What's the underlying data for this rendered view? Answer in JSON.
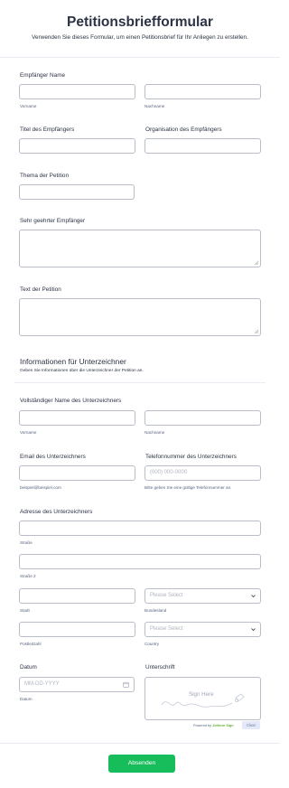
{
  "form": {
    "title": "Petitionsbriefformular",
    "subtitle": "Verwenden Sie dieses Formular, um einen Petitionsbrief für Ihr Anliegen zu erstellen."
  },
  "recipient": {
    "name_label": "Empfänger Name",
    "first_sublabel": "Vorname",
    "last_sublabel": "Nachname",
    "title_label": "Titel des Empfängers",
    "org_label": "Organisation des Empfängers",
    "topic_label": "Thema der Petition",
    "salutation_label": "Sehr geehrter Empfänger",
    "petition_text_label": "Text der Petition"
  },
  "signer_section": {
    "heading": "Informationen für Unterzeichner",
    "description": "Geben Sie Informationen über die Unterzeichner der Petition an.",
    "fullname_label": "Vollständiger Name des Unterzeichners",
    "first_sublabel": "Vorname",
    "last_sublabel": "Nachname",
    "email_label": "Email des Unterzeichners",
    "email_sublabel": "beispiel@beispiel.com",
    "phone_label": "Telefonnummer des Unterzeichners",
    "phone_placeholder": "(000) 000-0000",
    "phone_sublabel": "Bitte geben Sie eine gültige Telefonnummer an.",
    "address_label": "Adresse des Unterzeichners",
    "street_sublabel": "Straße",
    "street2_sublabel": "Straße 2",
    "city_sublabel": "Stadt",
    "state_placeholder": "Please Select",
    "state_sublabel": "Bundesland",
    "zip_sublabel": "Postleitzahl",
    "country_placeholder": "Please Select",
    "country_sublabel": "Country",
    "date_label": "Datum",
    "date_placeholder": "MM-DD-YYYY",
    "date_sublabel": "Datum",
    "signature_label": "Unterschrift",
    "sign_here": "Sign Here",
    "powered_by": "Powered by",
    "powered_brand": "Jotform Sign",
    "clear_label": "Clear"
  },
  "submit_label": "Absenden",
  "colors": {
    "submit": "#18bd5b",
    "border": "#b8bdc9",
    "text": "#2c3345",
    "placeholder": "#b0b5c1"
  }
}
